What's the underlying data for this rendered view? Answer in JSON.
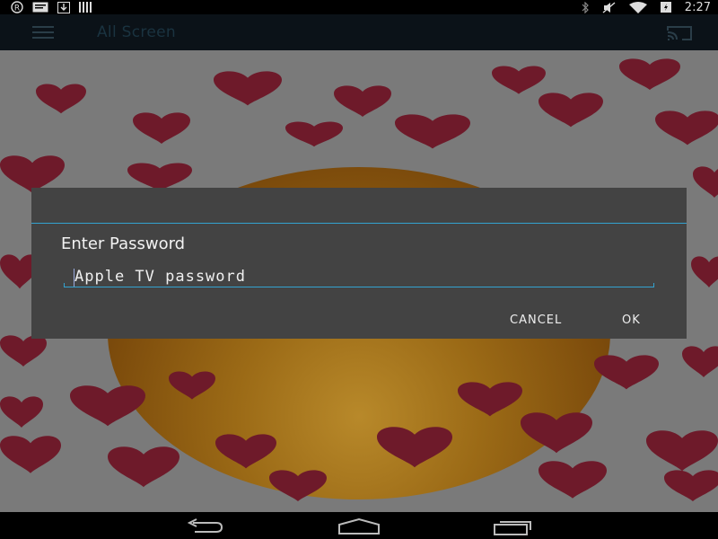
{
  "status_bar": {
    "time": "2:27",
    "left_icons": [
      "registered-icon",
      "message-icon",
      "download-icon",
      "barcode-icon"
    ],
    "right_icons": [
      "bluetooth-icon",
      "mute-icon",
      "wifi-icon",
      "battery-icon"
    ]
  },
  "action_bar": {
    "title": "All Screen",
    "menu_icon": "hamburger-icon",
    "cast_icon": "cast-icon"
  },
  "dialog": {
    "label": "Enter Password",
    "input_placeholder": "Apple TV password",
    "input_value": "",
    "cancel_label": "CANCEL",
    "ok_label": "OK",
    "accent_color": "#33a3d0"
  },
  "nav_bar": {
    "icons": [
      "back-icon",
      "home-icon",
      "recent-apps-icon"
    ]
  }
}
